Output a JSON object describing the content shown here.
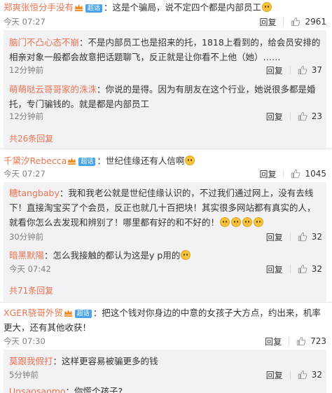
{
  "c1": {
    "user": "郑爽张恒分手没有",
    "vip": "超话",
    "text": "：这是个骗局，说不定四个都是内部员工",
    "time": "今天 07:27",
    "reply": "回复",
    "likes": "2961"
  },
  "c1r1": {
    "user": "脑门不凸心态不崩",
    "text": "：不是内部员工也是招来的托，1818上看到的，给会员安排的相亲对象一般都会故意把话题聊飞，反正就是让你看不上他（她）……",
    "time": "12分钟前",
    "reply": "回复",
    "likes": "37"
  },
  "c1r2": {
    "user": "萌萌哒云哥哥家的洙洙",
    "text": "：你说的是得。因为有朋友在这个行业，她说很多都是婚托，专门骗钱的。就是都是内部员工",
    "time": "12分钟前",
    "reply": "回复",
    "likes": "23"
  },
  "c1_more": "共26条回复",
  "c2": {
    "user": "千黛汐Rebecca",
    "vip": "超话",
    "text": "：世纪佳缘还有人信啊",
    "time": "今天 07:27",
    "reply": "回复",
    "likes": "1045"
  },
  "c2r1": {
    "user": "糖tangbaby",
    "text": "：我和我老公就是世纪佳缘认识的，不过我们通过网上，没有去线下！直接淘宝买了个会员，反正也就几十百把块！其实很多网站都有真实的人，就看你怎么去发现和辨别了！哪里都有好的和不好的！",
    "time": "30分钟前",
    "reply": "回复",
    "likes": "32"
  },
  "c2r2": {
    "user": "暗黑默陽",
    "text": "：怎么我接触的都认为这是y p用的",
    "time": "今天 07:42",
    "reply": "回复",
    "likes": "32"
  },
  "c2_more": "共71条回复",
  "c3": {
    "user": "XGER骁哥外贸",
    "vip": "超话",
    "text": "：把这个钱对你身边的中意的女孩子大方点，约出来，机率更大，还有其他收获！",
    "time": "今天 07:30",
    "reply": "回复",
    "likes": "723"
  },
  "c3r1": {
    "user": "莫跟我假打",
    "text": "：这样更容易被骗更多的钱",
    "time": "5分钟前",
    "reply": "回复",
    "likes": "32"
  },
  "c3r2": {
    "user": "Unsaosaomo",
    "text": "：你慌个孩子?"
  },
  "icons": {
    "like": "thumbs-up-icon",
    "crown": "crown-icon",
    "emoji": "smiley-emoji-icon"
  },
  "colors": {
    "username": "#eb7350",
    "subBg": "#f2f2f5",
    "vip": "#4aa4ea",
    "meta": "#808080"
  }
}
